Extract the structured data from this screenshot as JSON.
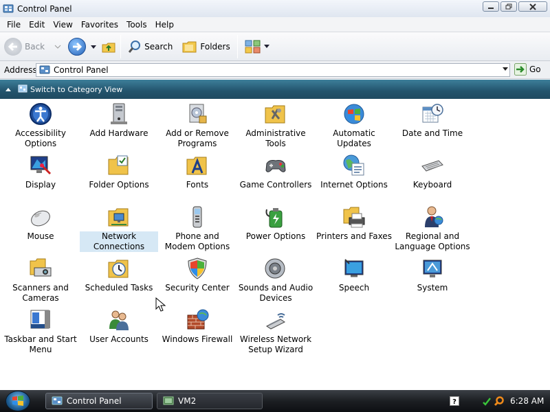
{
  "window": {
    "title": "Control Panel"
  },
  "menu": [
    "File",
    "Edit",
    "View",
    "Favorites",
    "Tools",
    "Help"
  ],
  "toolbar": {
    "back_label": "Back",
    "search_label": "Search",
    "folders_label": "Folders"
  },
  "address": {
    "label": "Address",
    "value": "Control Panel",
    "go_label": "Go"
  },
  "category_view": {
    "label": "Switch to Category View"
  },
  "items": [
    {
      "label": "Accessibility Options",
      "icon": "accessibility-icon"
    },
    {
      "label": "Add Hardware",
      "icon": "add-hardware-icon"
    },
    {
      "label": "Add or Remove Programs",
      "icon": "add-remove-programs-icon"
    },
    {
      "label": "Administrative Tools",
      "icon": "administrative-tools-icon"
    },
    {
      "label": "Automatic Updates",
      "icon": "automatic-updates-icon"
    },
    {
      "label": "Date and Time",
      "icon": "date-time-icon"
    },
    {
      "label": "Display",
      "icon": "display-icon"
    },
    {
      "label": "Folder Options",
      "icon": "folder-options-icon"
    },
    {
      "label": "Fonts",
      "icon": "fonts-icon"
    },
    {
      "label": "Game Controllers",
      "icon": "game-controllers-icon"
    },
    {
      "label": "Internet Options",
      "icon": "internet-options-icon"
    },
    {
      "label": "Keyboard",
      "icon": "keyboard-icon"
    },
    {
      "label": "Mouse",
      "icon": "mouse-icon"
    },
    {
      "label": "Network Connections",
      "icon": "network-connections-icon"
    },
    {
      "label": "Phone and Modem Options",
      "icon": "phone-modem-icon"
    },
    {
      "label": "Power Options",
      "icon": "power-options-icon"
    },
    {
      "label": "Printers and Faxes",
      "icon": "printers-faxes-icon"
    },
    {
      "label": "Regional and Language Options",
      "icon": "regional-language-icon"
    },
    {
      "label": "Scanners and Cameras",
      "icon": "scanners-cameras-icon"
    },
    {
      "label": "Scheduled Tasks",
      "icon": "scheduled-tasks-icon"
    },
    {
      "label": "Security Center",
      "icon": "security-center-icon"
    },
    {
      "label": "Sounds and Audio Devices",
      "icon": "sounds-audio-icon"
    },
    {
      "label": "Speech",
      "icon": "speech-icon"
    },
    {
      "label": "System",
      "icon": "system-icon"
    },
    {
      "label": "Taskbar and Start Menu",
      "icon": "taskbar-start-menu-icon"
    },
    {
      "label": "User Accounts",
      "icon": "user-accounts-icon"
    },
    {
      "label": "Windows Firewall",
      "icon": "windows-firewall-icon"
    },
    {
      "label": "Wireless Network Setup Wizard",
      "icon": "wireless-network-icon"
    }
  ],
  "selected_item": "Network Connections",
  "taskbar": {
    "buttons": [
      {
        "label": "Control Panel",
        "active": true
      },
      {
        "label": "VM2",
        "active": false
      }
    ],
    "clock": "6:28 AM"
  },
  "colors": {
    "category_bar": "#23536c",
    "taskbar": "#1c1f23",
    "selection": "#d6e8f5"
  }
}
